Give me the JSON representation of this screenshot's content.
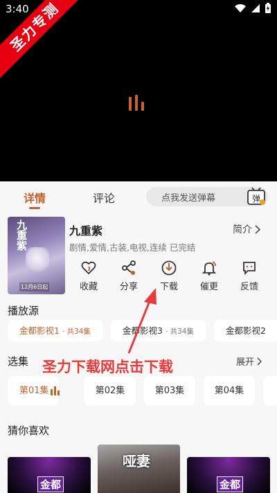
{
  "status_bar": {
    "time": "3:40"
  },
  "watermark": {
    "ribbon_text": "圣力专测"
  },
  "tabs": [
    {
      "label": "详情",
      "active": true
    },
    {
      "label": "评论",
      "active": false
    }
  ],
  "danmu": {
    "placeholder": "点我发送弹幕",
    "icon_text": "弹"
  },
  "show": {
    "poster_title": "九重紫",
    "poster_date": "12月6日起",
    "title": "九重紫",
    "intro_label": "简介",
    "tags": "剧情,爱情,古装,电视,连续 已完结"
  },
  "actions": [
    {
      "label": "收藏",
      "icon": "favorite-heart-icon"
    },
    {
      "label": "分享",
      "icon": "share-icon"
    },
    {
      "label": "下载",
      "icon": "download-icon"
    },
    {
      "label": "催更",
      "icon": "remind-bell-icon"
    },
    {
      "label": "反馈",
      "icon": "feedback-icon"
    }
  ],
  "sources": {
    "label": "播放源",
    "items": [
      {
        "name": "金都影视1",
        "count": "· 共34集",
        "active": true
      },
      {
        "name": "金都影视3",
        "count": "· 共34集",
        "active": false
      },
      {
        "name": "金都影视2",
        "count": "",
        "active": false
      }
    ]
  },
  "episodes": {
    "label": "选集",
    "expand_label": "展开",
    "items": [
      {
        "label": "第01集",
        "active": true
      },
      {
        "label": "第02集",
        "active": false
      },
      {
        "label": "第03集",
        "active": false
      },
      {
        "label": "第04集",
        "active": false
      },
      {
        "label": "",
        "active": false
      }
    ]
  },
  "recommend": {
    "label": "猜你喜欢",
    "items": [
      {
        "logo": "金都"
      },
      {
        "title": "哑妻"
      },
      {
        "logo": "金都"
      }
    ]
  },
  "annotation": {
    "text": "圣力下载网点击下载"
  },
  "colors": {
    "accent": "#c0622f",
    "annotation": "#e83a3a",
    "video_bg": "#000000"
  }
}
